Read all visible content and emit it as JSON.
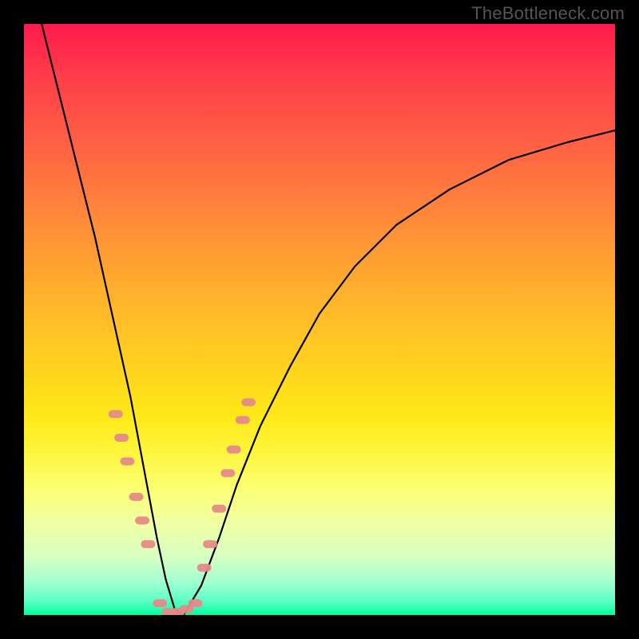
{
  "watermark": "TheBottleneck.com",
  "chart_data": {
    "type": "line",
    "title": "",
    "xlabel": "",
    "ylabel": "",
    "xlim": [
      0,
      100
    ],
    "ylim": [
      0,
      100
    ],
    "gradient_colors": {
      "top": "#ff1a4d",
      "mid_upper": "#ff9a35",
      "mid": "#ffe818",
      "mid_lower": "#d8ffc0",
      "bottom": "#00ff99"
    },
    "series": [
      {
        "name": "bottleneck-curve",
        "color": "#000000",
        "x": [
          3,
          6,
          9,
          12,
          14,
          16,
          18,
          19.5,
          21,
          22.5,
          24,
          25.5,
          27,
          30,
          33,
          36,
          40,
          45,
          50,
          56,
          63,
          72,
          82,
          92,
          100
        ],
        "y": [
          100,
          88,
          76,
          64,
          55,
          46,
          37,
          29,
          21,
          13,
          6,
          1,
          0,
          5,
          13,
          22,
          32,
          42,
          51,
          59,
          66,
          72,
          77,
          80,
          82
        ]
      }
    ],
    "marker_clusters": [
      {
        "name": "left-branch-markers",
        "color": "#e58a89",
        "points": [
          {
            "x": 15.5,
            "y": 34
          },
          {
            "x": 16.5,
            "y": 30
          },
          {
            "x": 17.5,
            "y": 26
          },
          {
            "x": 19.0,
            "y": 20
          },
          {
            "x": 20.0,
            "y": 16
          },
          {
            "x": 21.0,
            "y": 12
          }
        ]
      },
      {
        "name": "valley-markers",
        "color": "#e58a89",
        "points": [
          {
            "x": 23.0,
            "y": 2
          },
          {
            "x": 24.5,
            "y": 0.5
          },
          {
            "x": 26.0,
            "y": 0.5
          },
          {
            "x": 27.5,
            "y": 1
          },
          {
            "x": 29.0,
            "y": 2
          }
        ]
      },
      {
        "name": "right-branch-markers",
        "color": "#e58a89",
        "points": [
          {
            "x": 30.5,
            "y": 8
          },
          {
            "x": 31.5,
            "y": 12
          },
          {
            "x": 33.0,
            "y": 18
          },
          {
            "x": 34.5,
            "y": 24
          },
          {
            "x": 35.5,
            "y": 28
          },
          {
            "x": 37.0,
            "y": 33
          },
          {
            "x": 38.0,
            "y": 36
          }
        ]
      }
    ]
  }
}
